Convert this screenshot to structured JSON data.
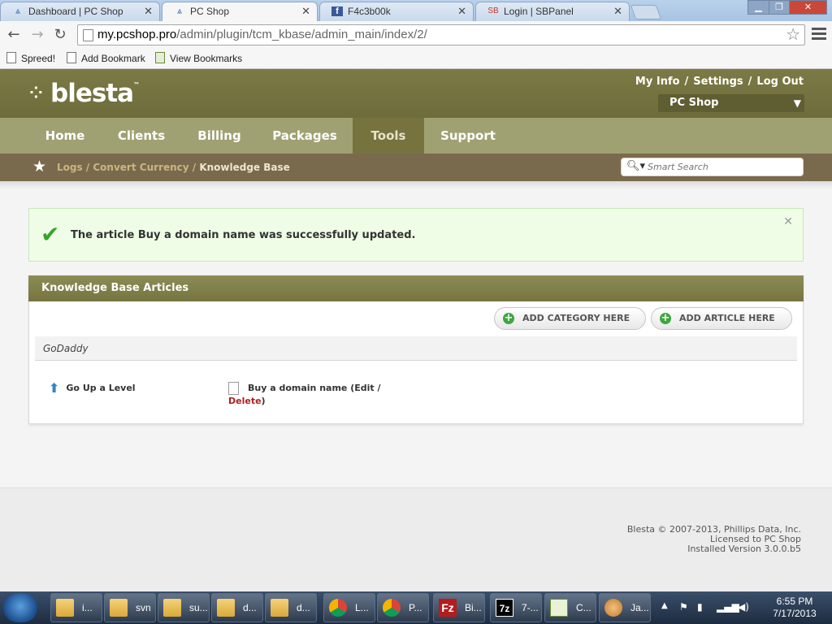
{
  "browser": {
    "tabs": [
      {
        "title": "Dashboard | PC Shop",
        "icon": "blesta-icon"
      },
      {
        "title": "PC Shop",
        "icon": "blesta-icon",
        "active": true
      },
      {
        "title": "F4c3b00k",
        "icon": "facebook-icon"
      },
      {
        "title": "Login | SBPanel",
        "icon": "sbpanel-icon",
        "icon_text": "SB"
      }
    ],
    "url_domain": "my.pcshop.pro",
    "url_path": "/admin/plugin/tcm_kbase/admin_main/index/2/",
    "bookmarks": [
      "Spreed!",
      "Add Bookmark",
      "View Bookmarks"
    ]
  },
  "header": {
    "logo": "blesta",
    "links": [
      "My Info",
      "Settings",
      "Log Out"
    ],
    "company": "PC Shop"
  },
  "nav": {
    "items": [
      "Home",
      "Clients",
      "Billing",
      "Packages",
      "Tools",
      "Support"
    ],
    "active": "Tools"
  },
  "breadcrumb": {
    "items": [
      "Logs",
      "Convert Currency"
    ],
    "current": "Knowledge Base"
  },
  "search": {
    "placeholder": "Smart Search"
  },
  "alert": {
    "message": "The article Buy a domain name was successfully updated."
  },
  "panel": {
    "title": "Knowledge Base Articles",
    "add_category": "ADD CATEGORY HERE",
    "add_article": "ADD ARTICLE HERE",
    "category": "GoDaddy",
    "go_up": "Go Up a Level",
    "article_name": "Buy a domain name",
    "edit": "Edit",
    "delete": "Delete"
  },
  "footer": {
    "line1": "Blesta © 2007-2013, Phillips Data, Inc.",
    "line2": "Licensed to PC Shop",
    "line3": "Installed Version 3.0.0.b5"
  },
  "taskbar": {
    "items": [
      {
        "label": "i...",
        "icon": "folder-icon"
      },
      {
        "label": "svn",
        "icon": "folder-icon"
      },
      {
        "label": "su...",
        "icon": "folder-icon"
      },
      {
        "label": "d...",
        "icon": "folder-icon"
      },
      {
        "label": "d...",
        "icon": "folder-icon"
      },
      {
        "label": "L...",
        "icon": "chrome-icon"
      },
      {
        "label": "P...",
        "icon": "chrome-icon"
      },
      {
        "label": "Bi...",
        "icon": "filezilla-icon"
      },
      {
        "label": "7-...",
        "icon": "7zip-icon"
      },
      {
        "label": "C...",
        "icon": "notepad-plus-icon"
      },
      {
        "label": "Ja...",
        "icon": "paint-icon"
      }
    ],
    "time": "6:55 PM",
    "date": "7/17/2013"
  }
}
